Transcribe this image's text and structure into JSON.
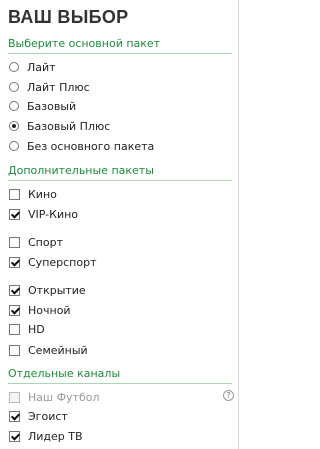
{
  "title": "ВАШ ВЫБОР",
  "sections": {
    "base": "Выберите основной пакет",
    "extra": "Дополнительные пакеты",
    "channels": "Отдельные каналы"
  },
  "base_packages": [
    {
      "label": "Лайт",
      "selected": false
    },
    {
      "label": "Лайт Плюс",
      "selected": false
    },
    {
      "label": "Базовый",
      "selected": false
    },
    {
      "label": "Базовый Плюс",
      "selected": true
    },
    {
      "label": "Без основного пакета",
      "selected": false
    }
  ],
  "extra_packages": [
    {
      "label": "Кино",
      "checked": false
    },
    {
      "label": "VIP-Кино",
      "checked": true
    },
    {
      "label": "Спорт",
      "checked": false
    },
    {
      "label": "Суперспорт",
      "checked": true
    },
    {
      "label": "Открытие",
      "checked": true
    },
    {
      "label": "Ночной",
      "checked": true
    },
    {
      "label": "HD",
      "checked": false
    },
    {
      "label": "Семейный",
      "checked": false
    }
  ],
  "channels": [
    {
      "label": "Наш Футбол",
      "checked": false,
      "disabled": true,
      "help_icon": "?"
    },
    {
      "label": "Эгоист",
      "checked": true,
      "disabled": false
    },
    {
      "label": "Лидер ТВ",
      "checked": true,
      "disabled": false
    }
  ]
}
